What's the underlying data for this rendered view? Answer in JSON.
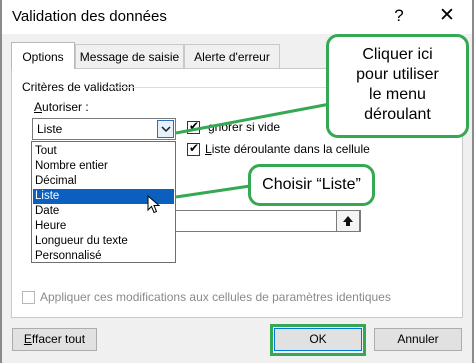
{
  "dialog": {
    "title": "Validation des données",
    "help_glyph": "?",
    "close_glyph": "✕"
  },
  "tabs": [
    {
      "label": "Options",
      "active": true
    },
    {
      "label": "Message de saisie",
      "active": false
    },
    {
      "label": "Alerte d'erreur",
      "active": false
    }
  ],
  "criteria": {
    "group_title": "Critères de validation",
    "autoriser_label_accel": "A",
    "autoriser_label_rest": "utoriser :",
    "select_value": "Liste",
    "options": [
      "Tout",
      "Nombre entier",
      "Décimal",
      "Liste",
      "Date",
      "Heure",
      "Longueur du texte",
      "Personnalisé"
    ],
    "selected_option": "Liste",
    "ignore_empty_label": "Ignorer si vide",
    "ignore_empty_visible": "gnorer si vide",
    "dropdown_in_cell_label": "Liste déroulante dans la cellule"
  },
  "apply_all_label": "Appliquer ces modifications aux cellules de paramètres identiques",
  "buttons": {
    "clear_all_accel": "E",
    "clear_all_rest": "ffacer tout",
    "ok": "OK",
    "cancel": "Annuler"
  },
  "callouts": {
    "top": [
      "Cliquer ici",
      "pour utiliser",
      "le menu",
      "déroulant"
    ],
    "middle": "Choisir “Liste”"
  },
  "colors": {
    "accent": "#0b5fbf",
    "callout_border": "#34a853"
  }
}
